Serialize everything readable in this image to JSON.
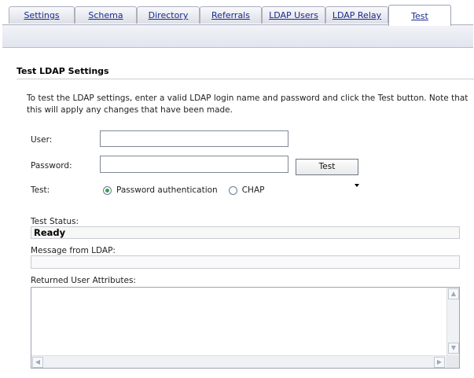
{
  "tabs": [
    {
      "label": "Settings",
      "active": false
    },
    {
      "label": "Schema",
      "active": false
    },
    {
      "label": "Directory",
      "active": false
    },
    {
      "label": "Referrals",
      "active": false
    },
    {
      "label": "LDAP Users",
      "active": false
    },
    {
      "label": "LDAP Relay",
      "active": false
    },
    {
      "label": "Test",
      "active": true
    }
  ],
  "section": {
    "title": "Test LDAP Settings",
    "description": "To test the LDAP settings, enter a valid LDAP login name and password and click the Test button. Note that this will apply any changes that have been made."
  },
  "form": {
    "user_label": "User:",
    "user_value": "",
    "password_label": "Password:",
    "password_value": "",
    "test_button": "Test",
    "test_label": "Test:",
    "options": [
      {
        "label": "Password authentication",
        "checked": true
      },
      {
        "label": "CHAP",
        "checked": false
      }
    ]
  },
  "status": {
    "label": "Test Status:",
    "value": "Ready"
  },
  "message": {
    "label": "Message from LDAP:",
    "value": ""
  },
  "attributes": {
    "label": "Returned User Attributes:",
    "value": ""
  },
  "icons": {
    "scroll_up": "scroll-up-arrow-icon",
    "scroll_down": "scroll-down-arrow-icon",
    "scroll_left": "scroll-left-arrow-icon",
    "scroll_right": "scroll-right-arrow-icon"
  },
  "colors": {
    "tab_link": "#1a2c8c",
    "radio_selected": "#3aa04a"
  }
}
